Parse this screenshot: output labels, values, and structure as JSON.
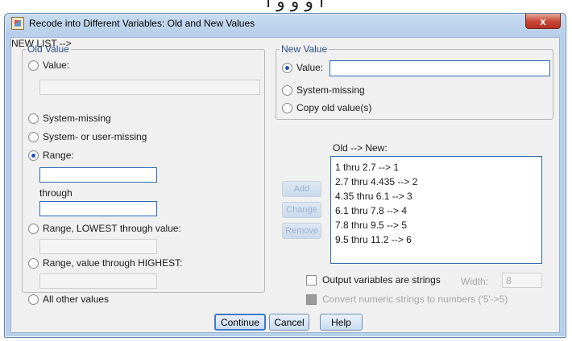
{
  "window": {
    "title": "Recode into Different Variables: Old and New Values",
    "close_glyph": "x",
    "app_icon": "spss-dialog-icon"
  },
  "old_value": {
    "legend": "Old Value",
    "value_label": "Value:",
    "value_input": "",
    "system_missing_label": "System-missing",
    "system_or_user_missing_label": "System- or user-missing",
    "range_label": "Range:",
    "range_from": "",
    "through_label": "through",
    "range_to": "",
    "range_lowest_label": "Range, LOWEST through value:",
    "range_lowest_input": "",
    "range_highest_label": "Range, value through HIGHEST:",
    "range_highest_input": "",
    "all_other_label": "All other values",
    "selected": "range"
  },
  "new_value": {
    "legend": "New Value",
    "value_label": "Value:",
    "value_input": "",
    "system_missing_label": "System-missing",
    "copy_old_label": "Copy old value(s)",
    "selected": "value"
  },
  "mapping": {
    "header": "Old --> New:",
    "add_label": "Add",
    "change_label": "Change",
    "remove_label": "Remove",
    "rules": [
      "1 thru 2.7 --> 1",
      "2.7 thru 4.435 --> 2",
      "4.35 thru 6.1 --> 3",
      "6.1 thru 7.8 --> 4",
      "7.8 thru 9.5 --> 5",
      "9.5 thru 11.2 --> 6"
    ]
  },
  "options": {
    "output_strings_label": "Output variables are strings",
    "width_label": "Width:",
    "width_value": "8",
    "convert_label": "Convert numeric strings to numbers ('5'->5)"
  },
  "buttons": {
    "continue_label": "Continue",
    "cancel_label": "Cancel",
    "help_label": "Help"
  },
  "colors": {
    "titlebar": "#b7cfea",
    "close_button": "#c9483a",
    "client_background": "#f0f0f0",
    "input_border": "#2d6bb5",
    "legend_text": "#2a4f8a"
  }
}
